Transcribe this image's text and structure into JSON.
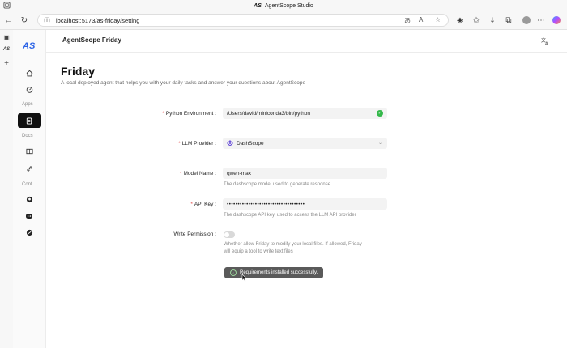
{
  "window": {
    "title": "AgentScope Studio",
    "brand_mark": "AS"
  },
  "browser": {
    "url_host": "localhost",
    "url_path": ":5173/as-friday/setting",
    "sidebar_items": [
      "tab-icon",
      "agentscope-tab",
      "add-icon"
    ]
  },
  "app": {
    "logo": "AS",
    "header_title": "AgentScope Friday",
    "sections": {
      "apps": "Apps",
      "docs": "Docs",
      "cont": "Cont"
    }
  },
  "page": {
    "title": "Friday",
    "description": "A local deployed agent that helps you with your daily tasks and answer your questions about AgentScope"
  },
  "form": {
    "python_env": {
      "label": "Python Environment",
      "value": "/Users/david/miniconda3/bin/python"
    },
    "llm_provider": {
      "label": "LLM Provider",
      "value": "DashScope"
    },
    "model_name": {
      "label": "Model Name",
      "value": "qwen-max",
      "help": "The dashscope model used to generate response"
    },
    "api_key": {
      "label": "API Key",
      "value": "••••••••••••••••••••••••••••••••••••",
      "help": "The dashscope API key, used to access the LLM API provider"
    },
    "write_permission": {
      "label": "Write Permission",
      "enabled": false,
      "help_line1": "Whether allow Friday to modify your local files. If allowed, Friday",
      "help_line2": "will equip a tool to write text files"
    }
  },
  "toast": {
    "message": "Requirements installed successfully."
  },
  "colors": {
    "accent": "#2c63e6",
    "success": "#34b84a",
    "required": "#e54b4b",
    "active_nav": "#111111"
  }
}
